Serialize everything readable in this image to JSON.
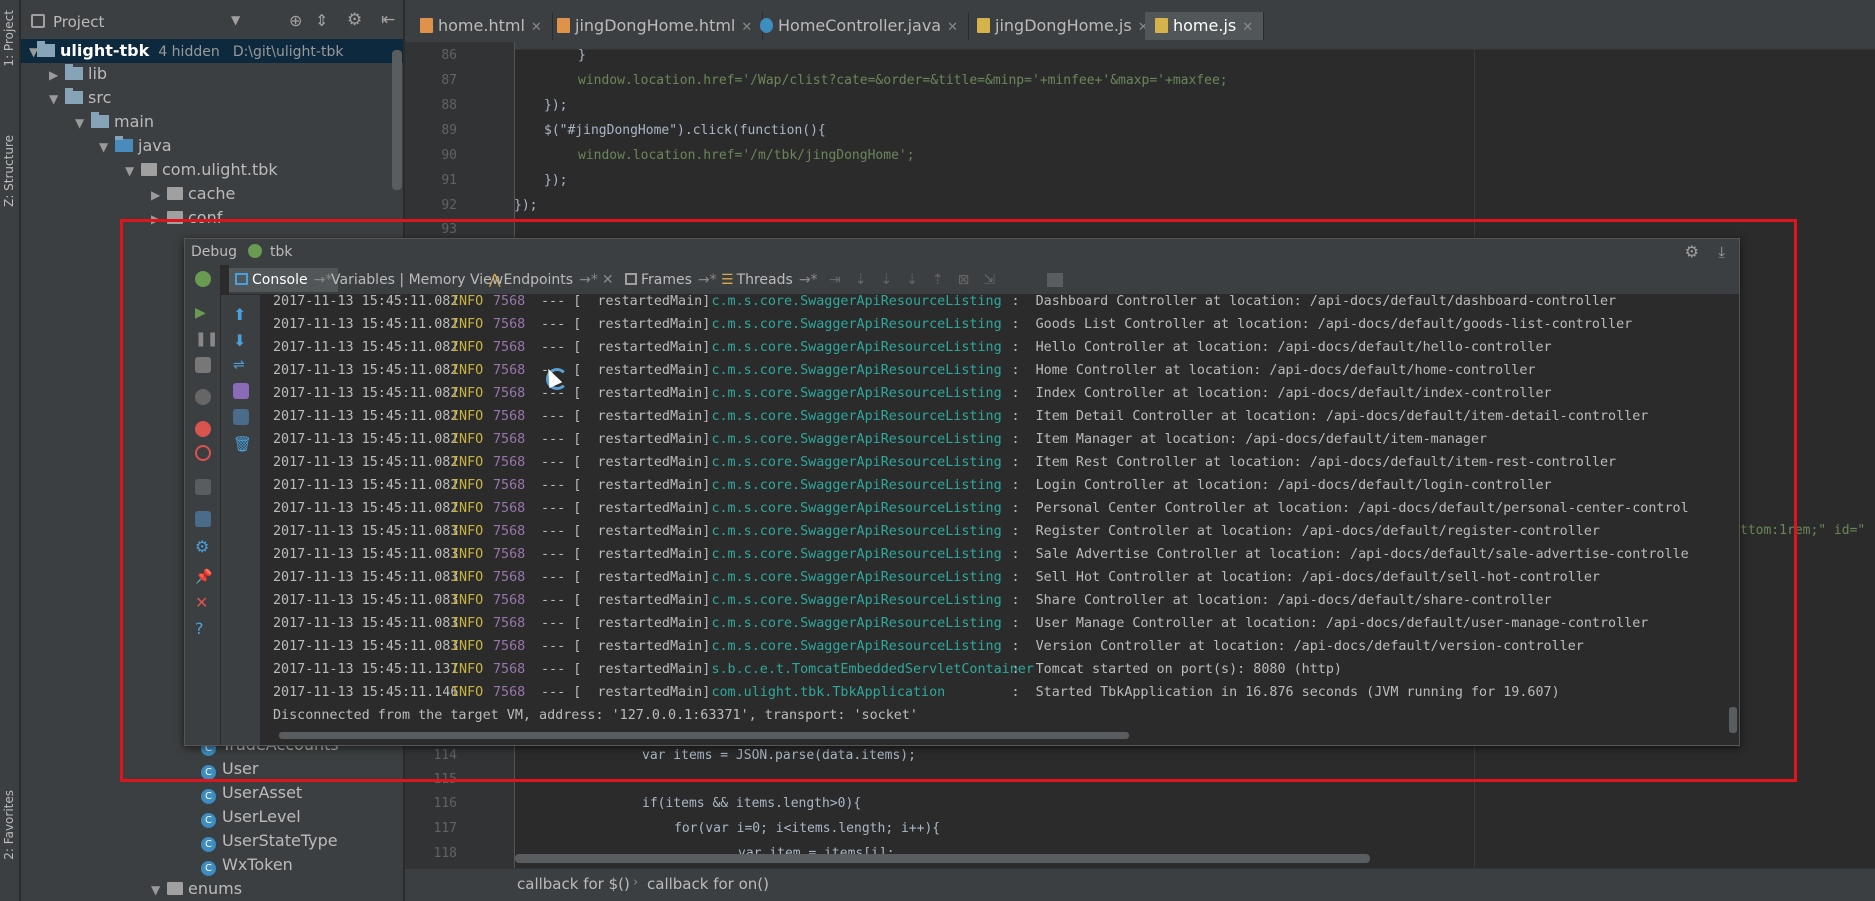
{
  "left_strip": {
    "project_tab": "1: Project",
    "structure_tab": "Z: Structure",
    "favorites_tab": "2: Favorites"
  },
  "project_panel": {
    "title": "Project",
    "root": {
      "name": "ulight-tbk",
      "hidden": "4 hidden",
      "path": "D:\\git\\ulight-tbk"
    },
    "tree": [
      {
        "label": "lib",
        "kind": "folder",
        "expanded": false
      },
      {
        "label": "src",
        "kind": "folder",
        "expanded": true
      },
      {
        "label": "main",
        "kind": "folder",
        "expanded": true
      },
      {
        "label": "java",
        "kind": "folder",
        "expanded": true
      },
      {
        "label": "com.ulight.tbk",
        "kind": "package",
        "expanded": true
      },
      {
        "label": "cache",
        "kind": "package",
        "expanded": false
      },
      {
        "label": "conf",
        "kind": "package",
        "expanded": false
      }
    ],
    "classes": [
      "TradeAccounts",
      "User",
      "UserAsset",
      "UserLevel",
      "UserStateType",
      "WxToken"
    ],
    "bottom_item": "enums"
  },
  "editor": {
    "tabs": [
      {
        "label": "home.html",
        "icon": "html-file-icon",
        "active": false
      },
      {
        "label": "jingDongHome.html",
        "icon": "html-file-icon",
        "active": false
      },
      {
        "label": "HomeController.java",
        "icon": "java-class-icon",
        "active": false
      },
      {
        "label": "jingDongHome.js",
        "icon": "js-file-icon",
        "active": false
      },
      {
        "label": "home.js",
        "icon": "js-file-icon",
        "active": true
      }
    ],
    "lines_top": [
      {
        "num": "86",
        "text": "}"
      },
      {
        "num": "87",
        "text": "window.location.href='/Wap/clist?cate=&order=&title=&minp='+minfee+'&maxp='+maxfee;"
      },
      {
        "num": "88",
        "text": "});"
      },
      {
        "num": "89",
        "text": "$(\"#jingDongHome\").click(function(){"
      },
      {
        "num": "90",
        "text": "window.location.href='/m/tbk/jingDongHome';"
      },
      {
        "num": "91",
        "text": "});"
      },
      {
        "num": "92",
        "text": "});"
      },
      {
        "num": "93",
        "text": ""
      }
    ],
    "lines_bottom": [
      {
        "num": "114",
        "text": "var items = JSON.parse(data.items);"
      },
      {
        "num": "115",
        "text": ""
      },
      {
        "num": "116",
        "text": "if(items && items.length>0){"
      },
      {
        "num": "117",
        "text": "for(var i=0; i<items.length; i++){"
      },
      {
        "num": "118",
        "text": "var item = items[i];"
      }
    ],
    "right_fragment": "ttom:1rem;\" id=\"",
    "breadcrumb": [
      "callback for $()",
      "callback for on()"
    ]
  },
  "debug": {
    "title": "Debug",
    "config": "tbk",
    "tabs": [
      {
        "label": "Console",
        "active": true
      },
      {
        "label": "Variables | Memory View",
        "active": false
      },
      {
        "label": "Endpoints",
        "active": false
      },
      {
        "label": "Frames",
        "active": false
      },
      {
        "label": "Threads",
        "active": false
      }
    ],
    "log": [
      {
        "ts": "2017-11-13 15:45:11.082",
        "lvl": "INFO",
        "pid": "7568",
        "thread": "restartedMain]",
        "logger": "c.m.s.core.SwaggerApiResourceListing",
        "msg": "Dashboard Controller at location: /api-docs/default/dashboard-controller"
      },
      {
        "ts": "2017-11-13 15:45:11.082",
        "lvl": "INFO",
        "pid": "7568",
        "thread": "restartedMain]",
        "logger": "c.m.s.core.SwaggerApiResourceListing",
        "msg": "Goods List Controller at location: /api-docs/default/goods-list-controller"
      },
      {
        "ts": "2017-11-13 15:45:11.082",
        "lvl": "INFO",
        "pid": "7568",
        "thread": "restartedMain]",
        "logger": "c.m.s.core.SwaggerApiResourceListing",
        "msg": "Hello Controller at location: /api-docs/default/hello-controller"
      },
      {
        "ts": "2017-11-13 15:45:11.082",
        "lvl": "INFO",
        "pid": "7568",
        "thread": "restartedMain]",
        "logger": "c.m.s.core.SwaggerApiResourceListing",
        "msg": "Home Controller at location: /api-docs/default/home-controller"
      },
      {
        "ts": "2017-11-13 15:45:11.082",
        "lvl": "INFO",
        "pid": "7568",
        "thread": "restartedMain]",
        "logger": "c.m.s.core.SwaggerApiResourceListing",
        "msg": "Index Controller at location: /api-docs/default/index-controller"
      },
      {
        "ts": "2017-11-13 15:45:11.082",
        "lvl": "INFO",
        "pid": "7568",
        "thread": "restartedMain]",
        "logger": "c.m.s.core.SwaggerApiResourceListing",
        "msg": "Item Detail Controller at location: /api-docs/default/item-detail-controller"
      },
      {
        "ts": "2017-11-13 15:45:11.082",
        "lvl": "INFO",
        "pid": "7568",
        "thread": "restartedMain]",
        "logger": "c.m.s.core.SwaggerApiResourceListing",
        "msg": "Item Manager at location: /api-docs/default/item-manager"
      },
      {
        "ts": "2017-11-13 15:45:11.082",
        "lvl": "INFO",
        "pid": "7568",
        "thread": "restartedMain]",
        "logger": "c.m.s.core.SwaggerApiResourceListing",
        "msg": "Item Rest Controller at location: /api-docs/default/item-rest-controller"
      },
      {
        "ts": "2017-11-13 15:45:11.082",
        "lvl": "INFO",
        "pid": "7568",
        "thread": "restartedMain]",
        "logger": "c.m.s.core.SwaggerApiResourceListing",
        "msg": "Login Controller at location: /api-docs/default/login-controller"
      },
      {
        "ts": "2017-11-13 15:45:11.082",
        "lvl": "INFO",
        "pid": "7568",
        "thread": "restartedMain]",
        "logger": "c.m.s.core.SwaggerApiResourceListing",
        "msg": "Personal Center Controller at location: /api-docs/default/personal-center-control"
      },
      {
        "ts": "2017-11-13 15:45:11.083",
        "lvl": "INFO",
        "pid": "7568",
        "thread": "restartedMain]",
        "logger": "c.m.s.core.SwaggerApiResourceListing",
        "msg": "Register Controller at location: /api-docs/default/register-controller"
      },
      {
        "ts": "2017-11-13 15:45:11.083",
        "lvl": "INFO",
        "pid": "7568",
        "thread": "restartedMain]",
        "logger": "c.m.s.core.SwaggerApiResourceListing",
        "msg": "Sale Advertise Controller at location: /api-docs/default/sale-advertise-controlle"
      },
      {
        "ts": "2017-11-13 15:45:11.083",
        "lvl": "INFO",
        "pid": "7568",
        "thread": "restartedMain]",
        "logger": "c.m.s.core.SwaggerApiResourceListing",
        "msg": "Sell Hot Controller at location: /api-docs/default/sell-hot-controller"
      },
      {
        "ts": "2017-11-13 15:45:11.083",
        "lvl": "INFO",
        "pid": "7568",
        "thread": "restartedMain]",
        "logger": "c.m.s.core.SwaggerApiResourceListing",
        "msg": "Share Controller at location: /api-docs/default/share-controller"
      },
      {
        "ts": "2017-11-13 15:45:11.083",
        "lvl": "INFO",
        "pid": "7568",
        "thread": "restartedMain]",
        "logger": "c.m.s.core.SwaggerApiResourceListing",
        "msg": "User Manage Controller at location: /api-docs/default/user-manage-controller"
      },
      {
        "ts": "2017-11-13 15:45:11.083",
        "lvl": "INFO",
        "pid": "7568",
        "thread": "restartedMain]",
        "logger": "c.m.s.core.SwaggerApiResourceListing",
        "msg": "Version Controller at location: /api-docs/default/version-controller"
      },
      {
        "ts": "2017-11-13 15:45:11.137",
        "lvl": "INFO",
        "pid": "7568",
        "thread": "restartedMain]",
        "logger": "s.b.c.e.t.TomcatEmbeddedServletContainer",
        "msg": "Tomcat started on port(s): 8080 (http)"
      },
      {
        "ts": "2017-11-13 15:45:11.146",
        "lvl": "INFO",
        "pid": "7568",
        "thread": "restartedMain]",
        "logger": "com.ulight.tbk.TbkApplication",
        "msg": "Started TbkApplication in 16.876 seconds (JVM running for 19.607)"
      }
    ],
    "disconnect": "Disconnected from the target VM, address: '127.0.0.1:63371', transport: 'socket'"
  },
  "colors": {
    "highlight": "#e0141c",
    "selection": "#0d293e",
    "log_logger": "#2ea89c",
    "log_level": "#c9b342"
  }
}
